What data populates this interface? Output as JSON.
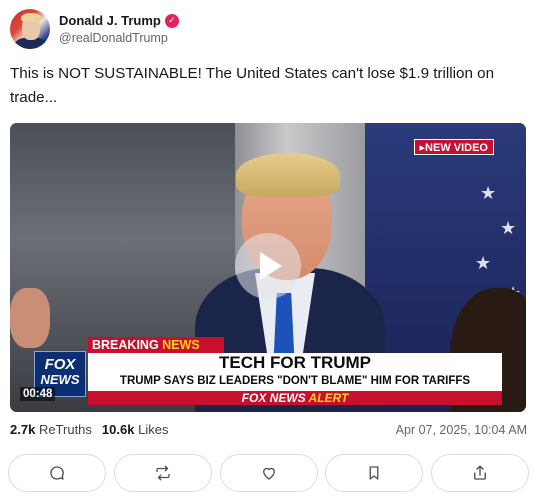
{
  "author": {
    "display_name": "Donald J. Trump",
    "handle": "@realDonaldTrump",
    "verified_icon": "verified-badge-icon"
  },
  "post": {
    "text": "This is NOT SUSTAINABLE! The United States can't lose $1.9 trillion on trade..."
  },
  "video": {
    "badge": "▸NEW VIDEO",
    "breaking_prefix": "BREAKING ",
    "breaking_suffix": "NEWS",
    "headline": "TECH FOR TRUMP",
    "subheadline": "TRUMP SAYS BIZ LEADERS \"DON'T BLAME\" HIM FOR TARIFFS",
    "alert_prefix": "FOX NEWS ",
    "alert_suffix": "ALERT",
    "logo_top": "FOX",
    "logo_bottom": "NEWS",
    "timecode": "00:48",
    "play_icon": "play-icon"
  },
  "stats": {
    "retruths_count": "2.7k",
    "retruths_label": "ReTruths",
    "likes_count": "10.6k",
    "likes_label": "Likes",
    "timestamp": "Apr 07, 2025, 10:04 AM"
  },
  "actions": [
    "reply-icon",
    "retruth-icon",
    "like-icon",
    "bookmark-icon",
    "share-icon"
  ],
  "colors": {
    "verified": "#e0245e",
    "fox_red": "#c8102e",
    "fox_blue": "#0c2f73"
  }
}
